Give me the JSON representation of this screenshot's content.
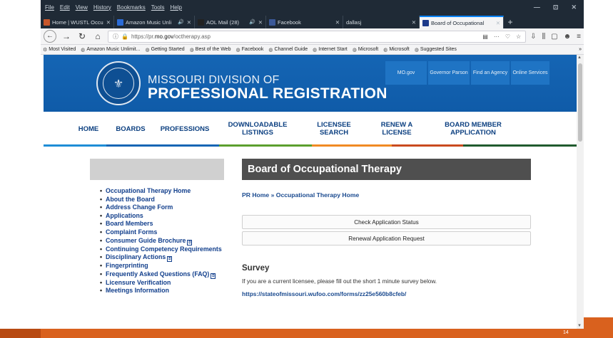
{
  "menu": [
    "File",
    "Edit",
    "View",
    "History",
    "Bookmarks",
    "Tools",
    "Help"
  ],
  "window_controls": [
    "—",
    "⊡",
    "✕"
  ],
  "tabs": [
    {
      "title": "Home | WUSTL Occupa",
      "audio": "",
      "favcolor": "#c8572b"
    },
    {
      "title": "Amazon Music Unli",
      "audio": "🔊",
      "favcolor": "#2b6bd6"
    },
    {
      "title": "AOL Mail (28)",
      "audio": "🔊",
      "favcolor": "#222222"
    },
    {
      "title": "Facebook",
      "audio": "",
      "favcolor": "#3b5998"
    },
    {
      "title": "dallasj",
      "audio": "",
      "favcolor": ""
    },
    {
      "title": "Board of Occupational",
      "audio": "",
      "favcolor": "#1d3a8a"
    }
  ],
  "nav": {
    "back": "←",
    "forward": "→",
    "reload": "↻",
    "home": "⌂",
    "url_prefix": "https://pr.",
    "url_domain": "mo.gov",
    "url_path": "/octherapy.asp",
    "url_right_icons": [
      "▤",
      "···",
      "♡",
      "☆"
    ],
    "toolbar_icons": [
      "⇩",
      "⫼",
      "▢",
      "☻",
      "≡"
    ]
  },
  "bookmarks": [
    "Most Visited",
    "Amazon Music Unlimit...",
    "Getting Started",
    "Best of the Web",
    "Facebook",
    "Channel Guide",
    "Internet Start",
    "Microsoft",
    "Microsoft",
    "Suggested Sites"
  ],
  "bookmarks_more": "»",
  "site": {
    "title_line1": "MISSOURI DIVISION OF",
    "title_line2": "PROFESSIONAL REGISTRATION",
    "seal_glyph": "⚜",
    "top_links": [
      "MO.gov",
      "Governor Parson",
      "Find an Agency",
      "Online Services"
    ],
    "main_nav": [
      "HOME",
      "BOARDS",
      "PROFESSIONS",
      "DOWNLOADABLE LISTINGS",
      "LICENSEE SEARCH",
      "RENEW A LICENSE",
      "BOARD MEMBER APPLICATION"
    ]
  },
  "sidebar": [
    {
      "label": "Occupational Therapy Home",
      "pdf": false
    },
    {
      "label": "About the Board",
      "pdf": false
    },
    {
      "label": "Address Change Form",
      "pdf": false
    },
    {
      "label": "Applications",
      "pdf": false
    },
    {
      "label": "Board Members",
      "pdf": false
    },
    {
      "label": "Complaint Forms",
      "pdf": false
    },
    {
      "label": "Consumer Guide Brochure",
      "pdf": true
    },
    {
      "label": "Continuing Competency Requirements",
      "pdf": false
    },
    {
      "label": "Disciplinary Actions",
      "pdf": true
    },
    {
      "label": "Fingerprinting",
      "pdf": false
    },
    {
      "label": "Frequently Asked Questions (FAQ)",
      "pdf": true
    },
    {
      "label": "Licensure Verification",
      "pdf": false
    },
    {
      "label": "Meetings Information",
      "pdf": false
    }
  ],
  "main": {
    "board_title": "Board of Occupational Therapy",
    "crumb_home": "PR Home",
    "crumb_sep": "»",
    "crumb_current": "Occupational Therapy Home",
    "button1": "Check Application Status",
    "button2": "Renewal Application Request",
    "survey_heading": "Survey",
    "survey_text": "If you are a current licensee, please fill out the short 1 minute survey below.",
    "survey_link": "https://stateofmissouri.wufoo.com/forms/zz25e560b8cfeb/"
  },
  "slide": {
    "page_number": "14"
  },
  "colors": {
    "banner": "#1565b4",
    "nav_text": "#0b3f80",
    "link": "#1a4a8f",
    "accent_orange": "#d9611e"
  }
}
